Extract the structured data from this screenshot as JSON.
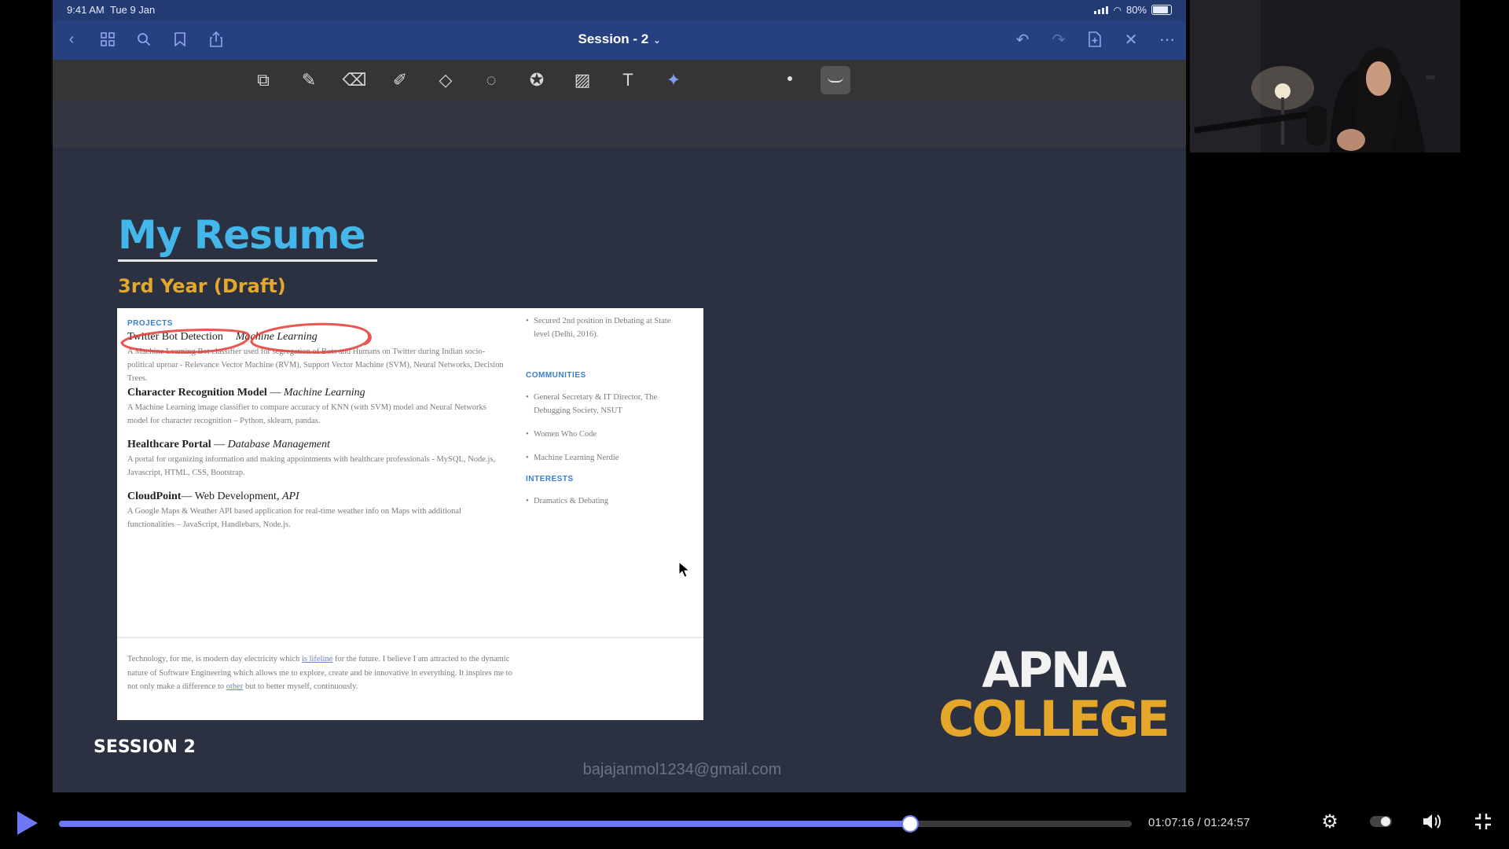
{
  "status_bar": {
    "time": "9:41 AM",
    "date": "Tue 9 Jan",
    "battery": "80%"
  },
  "nav": {
    "title": "Session - 2"
  },
  "slide": {
    "title": "My Resume",
    "subtitle": "3rd Year (Draft)",
    "session_label": "SESSION 2",
    "email_watermark": "bajajanmol1234@gmail.com",
    "logo_line1": "APNA",
    "logo_line2": "COLLEGE"
  },
  "resume": {
    "projects_heading": "PROJECTS",
    "projects": [
      {
        "name": "Twitter Bot Detection",
        "sep": "",
        "tag": "Machine Learning",
        "desc": "A Machine Learning Bot classifier used for segregation of Bots and Humans on Twitter during Indian socio-political uproar - Relevance Vector Machine (RVM), Support Vector Machine (SVM), Neural Networks, Decision Trees."
      },
      {
        "name": "Character Recognition Model",
        "sep": " — ",
        "tag": "Machine Learning",
        "desc": "A Machine Learning image classifier to compare accuracy of KNN (with SVM) model and Neural Networks model for character recognition – Python, sklearn, pandas."
      },
      {
        "name": "Healthcare Portal",
        "sep": " — ",
        "tag": "Database Management",
        "desc": "A portal for organizing information and making appointments with healthcare professionals - MySQL, Node.js, Javascript, HTML, CSS, Bootstrap."
      },
      {
        "name": "CloudPoint",
        "sep": "— Web Development, ",
        "tag": "API",
        "desc": "A Google Maps & Weather API based application for real-time weather info on Maps with additional functionalities – JavaScript, Handlebars, Node.js."
      }
    ],
    "achievement": "Secured 2nd position in Debating at State level (Delhi, 2016).",
    "communities_heading": "COMMUNITIES",
    "communities": [
      "General Secretary & IT Director, The Debugging Society, NSUT",
      "Women Who Code",
      "Machine Learning Nerdie"
    ],
    "interests_heading": "INTERESTS",
    "interests": [
      "Dramatics & Debating"
    ],
    "summary_1": "Technology, for me, is modern day electricity which ",
    "summary_link1": "is lifeline",
    "summary_2": " for the future. I believe I am attracted to the dynamic nature of Software Engineering which allows me to explore, create and be innovative in everything. It inspires me to not only make a difference to ",
    "summary_link2": "other",
    "summary_3": " but to better myself, continuously."
  },
  "player": {
    "current_time": "01:07:16",
    "duration": "01:24:57",
    "time_display": "01:07:16 / 01:24:57",
    "progress_fraction": 0.792
  },
  "colors": {
    "accent": "#6e78f4",
    "title_blue": "#44b7ea",
    "subtitle_gold": "#e2a92d",
    "annotation_red": "#e53935"
  }
}
